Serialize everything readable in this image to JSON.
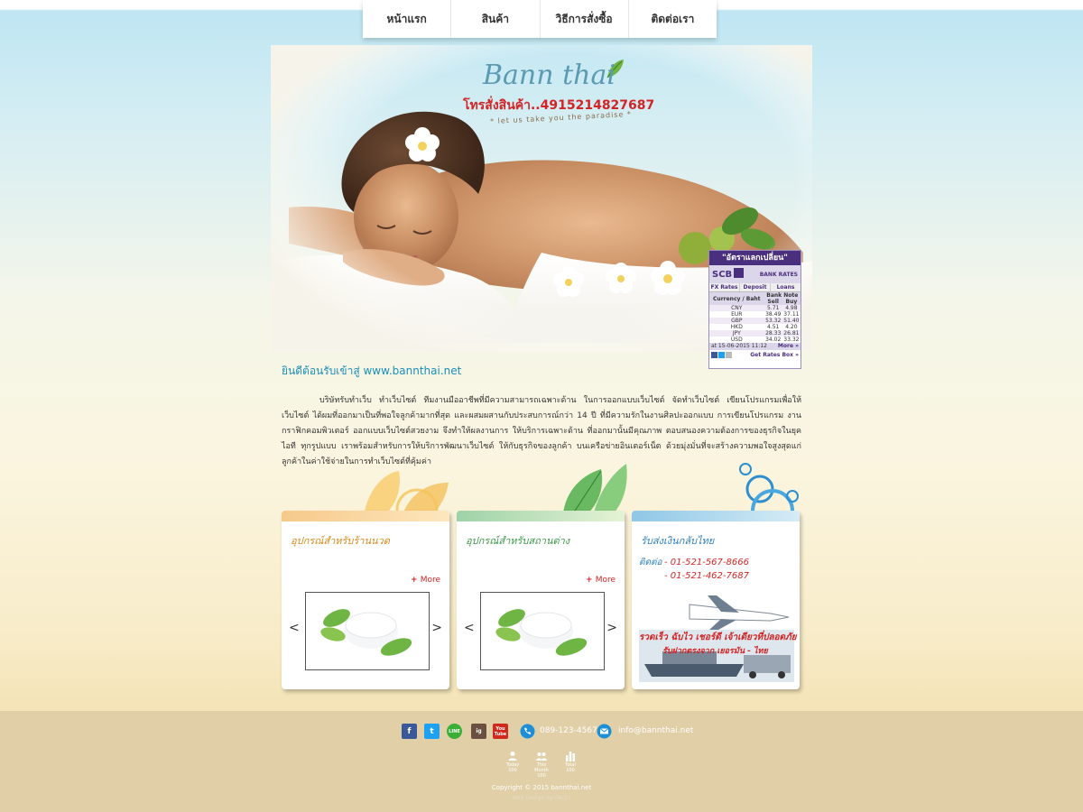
{
  "nav": {
    "items": [
      {
        "label": "หน้าแรก"
      },
      {
        "label": "สินค้า"
      },
      {
        "label": "วิธีการสั่งซื้อ"
      },
      {
        "label": "ติดต่อเรา"
      }
    ]
  },
  "logo": {
    "name": "Bann thai",
    "phone": "โทรสั่งสินค้า..4915214827687",
    "tagline": "* let us take you the paradise *"
  },
  "fx_widget": {
    "heading": "\"อัตราแลกเปลี่ยน\"",
    "bank": "SCB",
    "bank_rates_label": "BANK RATES",
    "tabs": [
      "FX Rates",
      "Deposit",
      "Loans"
    ],
    "col_currency": "Currency / Baht",
    "col_banknote": "Bank Note",
    "col_sell": "Sell",
    "col_buy": "Buy",
    "rows": [
      {
        "currency": "CNY",
        "sell": "5.71",
        "buy": "4.98"
      },
      {
        "currency": "EUR",
        "sell": "38.49",
        "buy": "37.11"
      },
      {
        "currency": "GBP",
        "sell": "53.32",
        "buy": "51.40"
      },
      {
        "currency": "HKD",
        "sell": "4.51",
        "buy": "4.20"
      },
      {
        "currency": "JPY",
        "sell": "28.33",
        "buy": "26.81"
      },
      {
        "currency": "USD",
        "sell": "34.02",
        "buy": "33.32"
      }
    ],
    "timestamp": "at 15-06-2015 11:12",
    "more": "More »",
    "get_rates": "Get Rates Box »"
  },
  "welcome": "ยินดีต้อนรับเข้าสู่  www.bannthai.net",
  "intro": "บริษัทรับทำเว็บ ทำเว็บไซต์ ทีมงานมืออาชีพที่มีความสามารถเฉพาะด้าน ในการออกแบบเว็บไซต์ จัดทำเว็บไซต์ เขียนโปรแกรมเพื่อให้เว็บไซต์ ได้ผมที่ออกมาเป็นที่พอใจลูกค้ามากที่สุด และผสมผสานกับประสบการณ์กว่า 14 ปี ที่มีความรักในงานศิลปะออกแบบ การเขียนโปรแกรม งานกราฟิกคอมพิวเตอร์ ออกแบบเว็บไซต์สวยงาม จึงทำให้ผลงานการ ให้บริการเฉพาะด้าน ที่ออกมานั้นมีคุณภาพ ตอบสนองความต้องการของธุรกิจในยุคไอที ทุกรูปแบบ เราพร้อมสำหรับการให้บริการพัฒนาเว็บไซต์ ให้กับธุรกิจของลูกค้า บนเครือข่ายอินเตอร์เน็ต ด้วยมุ่งมั่นที่จะสร้างความพอใจสูงสุดแก่ลูกค้าในค่าใช้จ่ายในการทำเว็บไซต์ที่คุ้มค่า",
  "cards": [
    {
      "title": "อุปกรณ์สำหรับร้านนวด",
      "more": "More",
      "prev": "<",
      "next": ">"
    },
    {
      "title": "อุปกรณ์สำหรับสถานต่าง",
      "more": "More",
      "prev": "<",
      "next": ">"
    },
    {
      "title": "รับส่งเงินกลับไทย",
      "contact_label": "ติดต่อ",
      "phones": [
        "- 01-521-567-8666",
        "- 01-521-462-7687"
      ],
      "promo_line1": "รวดเร็ว ฉับไว เชอร์ดี เจ้าเดียวที่ปลอดภัย",
      "promo_line2": "รับฝากตรงจาก เยอรมัน - ไทย"
    }
  ],
  "footer": {
    "social": [
      "f",
      "t",
      "LINE",
      "ig",
      "You Tube"
    ],
    "phone": "089-123-4567",
    "email": "info@bannthai.net",
    "stats": [
      {
        "label": "Today",
        "value": "100"
      },
      {
        "label": "This Month",
        "value": "100"
      },
      {
        "label": "Total",
        "value": "100"
      }
    ],
    "copyright": "Copyright  © 2015  bannthai.net",
    "webdesign": "Web Design by iTechz"
  },
  "colors": {
    "accent_red": "#d22424",
    "welcome_blue": "#1a8fb8",
    "footer_bg": "#e0cfa7",
    "scb_purple": "#4b2f7f",
    "card1_top": "#f6c98a",
    "card2_top": "#9fd2a8",
    "card3_top": "#8fc7e6"
  }
}
